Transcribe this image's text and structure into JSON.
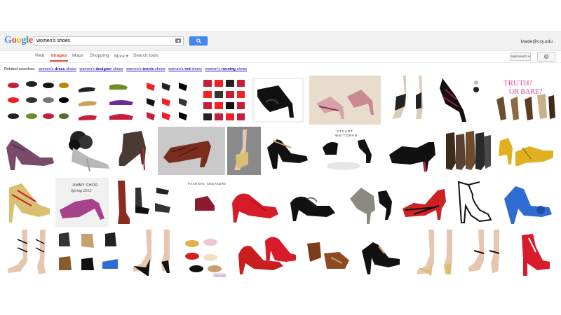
{
  "logo": {
    "letters": [
      "G",
      "o",
      "o",
      "g",
      "l",
      "e"
    ],
    "colors": [
      "#4285f4",
      "#ea4335",
      "#fbbc05",
      "#4285f4",
      "#34a853",
      "#ea4335"
    ]
  },
  "search": {
    "query": "women's shoes"
  },
  "user": {
    "email": "lwade@csy.edu"
  },
  "tabs": [
    "Web",
    "Images",
    "Maps",
    "Shopping",
    "More ▾",
    "Search tools"
  ],
  "active_tab": "Images",
  "toolbar": {
    "safesearch": "SafeSearch ▾",
    "settings_icon": "gear-icon"
  },
  "related": {
    "label": "Related searches:",
    "items": [
      {
        "prefix": "women's ",
        "bold": "dress",
        "suffix": " shoes"
      },
      {
        "prefix": "women's ",
        "bold": "designer",
        "suffix": " shoes"
      },
      {
        "prefix": "women's ",
        "bold": "tennis",
        "suffix": " shoes"
      },
      {
        "prefix": "women's ",
        "bold": "red",
        "suffix": " shoes"
      },
      {
        "prefix": "women's ",
        "bold": "running",
        "suffix": " shoes"
      }
    ]
  },
  "image_captions": {
    "truth_or_bare": "TRUTH? OR BARE?",
    "stuart": "STUART WEITZMAN",
    "jimmy_choo": "JIMMY CHOO SPRING 2013",
    "fashion": "FASHION, SNEAKERS",
    "pink_tag": "paper shoes"
  }
}
